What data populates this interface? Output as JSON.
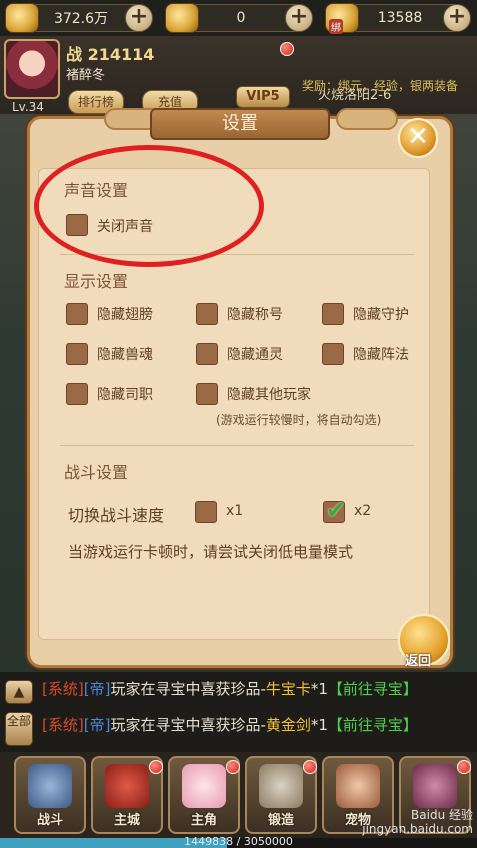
{
  "resources": [
    {
      "icon": "silver-coin-icon",
      "value": "372.6万"
    },
    {
      "icon": "gold-ingot-icon",
      "value": "0"
    },
    {
      "icon": "bound-ingot-icon",
      "value": "13588",
      "tag": "绑"
    }
  ],
  "player": {
    "power_label": "战",
    "power": "214114",
    "name": "褚醉冬",
    "level": "Lv.34",
    "vip": "VIP5"
  },
  "buttons": {
    "rank": "排行榜",
    "recharge": "充值"
  },
  "quest": {
    "title": "火烧洛阳2-6",
    "reward": "奖励：绑元，经验，银两装备"
  },
  "settings": {
    "title": "设置",
    "sound": {
      "heading": "声音设置",
      "mute_label": "关闭声音",
      "mute_checked": false
    },
    "display": {
      "heading": "显示设置",
      "options": [
        "隐藏翅膀",
        "隐藏称号",
        "隐藏守护",
        "隐藏兽魂",
        "隐藏通灵",
        "隐藏阵法",
        "隐藏司职",
        "隐藏其他玩家"
      ],
      "note": "(游戏运行较慢时，将自动勾选)"
    },
    "battle": {
      "heading": "战斗设置",
      "speed_label": "切换战斗速度",
      "speed_x1": "x1",
      "speed_x2": "x2",
      "selected_speed": "x2",
      "hint": "当游戏运行卡顿时，请尝试关闭低电量模式"
    },
    "back_label": "返回"
  },
  "chat": {
    "toggle_all": "全部",
    "messages": [
      {
        "sys": "[系统]",
        "chan": "[帝]",
        "text": "玩家在寻宝中喜获珍品-",
        "item": "牛宝卡",
        "count": "*1",
        "goto": "【前往寻宝】"
      },
      {
        "sys": "[系统]",
        "chan": "[帝]",
        "text": "玩家在寻宝中喜获珍品-",
        "item": "黄金剑",
        "count": "*1",
        "goto": "【前往寻宝】"
      }
    ]
  },
  "nav": [
    {
      "label": "战斗",
      "icon": "crossed-swords-icon"
    },
    {
      "label": "主城",
      "icon": "city-banner-icon"
    },
    {
      "label": "主角",
      "icon": "hero-portrait-icon"
    },
    {
      "label": "锻造",
      "icon": "hammer-icon"
    },
    {
      "label": "宠物",
      "icon": "pet-icon"
    },
    {
      "label": "",
      "icon": "helmet-icon"
    }
  ],
  "exp": {
    "text": "1449838 / 3050000",
    "fraction": 0.475
  },
  "watermark": {
    "line1": "Baidu 经验",
    "line2": "jingyan.baidu.com"
  },
  "colors": {
    "panel": "#e9cfa7",
    "checkbox": "#9a6a46",
    "highlight_ring": "#e02020",
    "exp": "#3fa0c0"
  }
}
